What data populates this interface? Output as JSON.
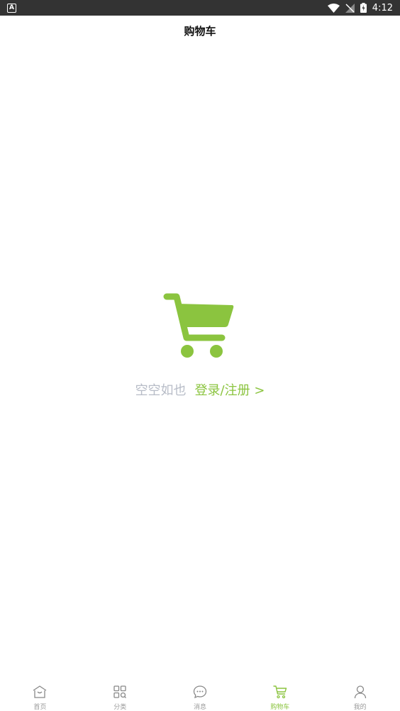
{
  "status_bar": {
    "app_badge": "A",
    "time": "4:12"
  },
  "header": {
    "title": "购物车"
  },
  "empty_state": {
    "message": "空空如也",
    "login_link": "登录/注册 >"
  },
  "tab_bar": {
    "tabs": [
      {
        "label": "首页",
        "icon": "home-icon"
      },
      {
        "label": "分类",
        "icon": "category-icon"
      },
      {
        "label": "消息",
        "icon": "message-icon"
      },
      {
        "label": "购物车",
        "icon": "cart-icon",
        "active": true
      },
      {
        "label": "我的",
        "icon": "profile-icon"
      }
    ]
  },
  "colors": {
    "accent": "#8bc43f",
    "muted_text": "#b7bcc7",
    "status_bar": "#333333"
  }
}
